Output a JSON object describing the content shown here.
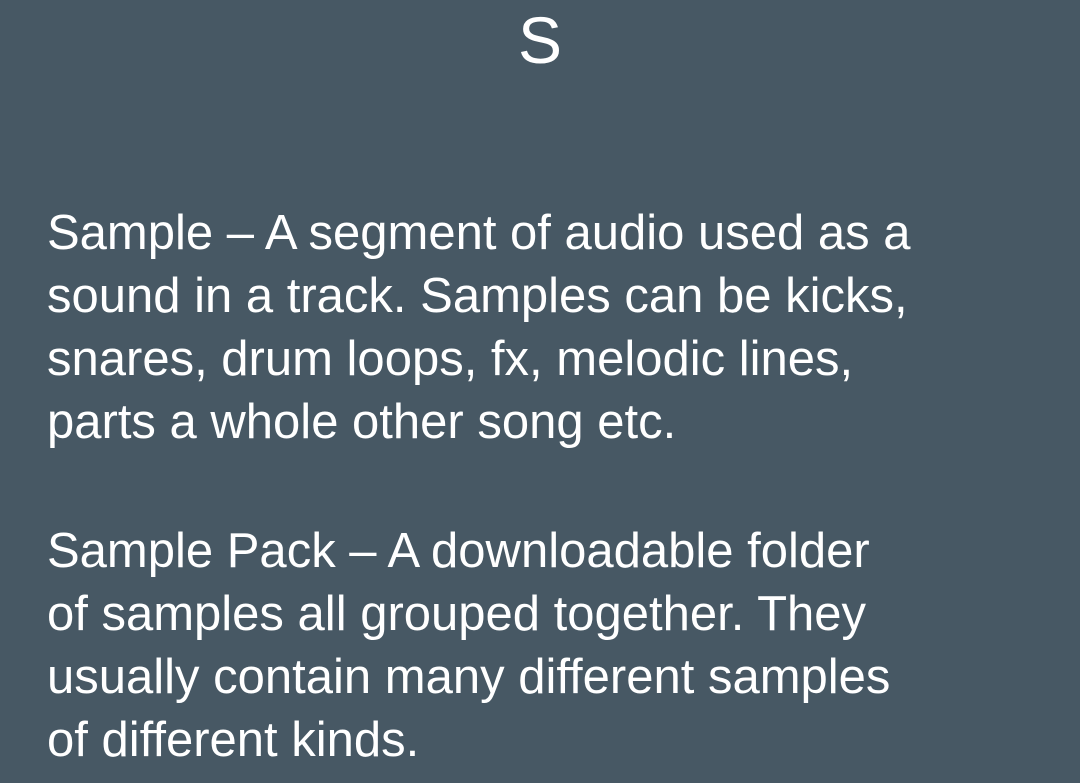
{
  "section": {
    "letter": "S"
  },
  "entries": [
    {
      "lines": [
        "Sample – A segment of audio used as a",
        "sound in a track. Samples can be kicks,",
        "snares, drum loops, fx, melodic lines,",
        "parts a whole other song etc."
      ]
    },
    {
      "lines": [
        "Sample Pack – A downloadable folder",
        "of samples all grouped together. They",
        "usually contain many different samples",
        "of different kinds."
      ]
    }
  ],
  "colors": {
    "background": "#475864",
    "text": "#ffffff"
  }
}
